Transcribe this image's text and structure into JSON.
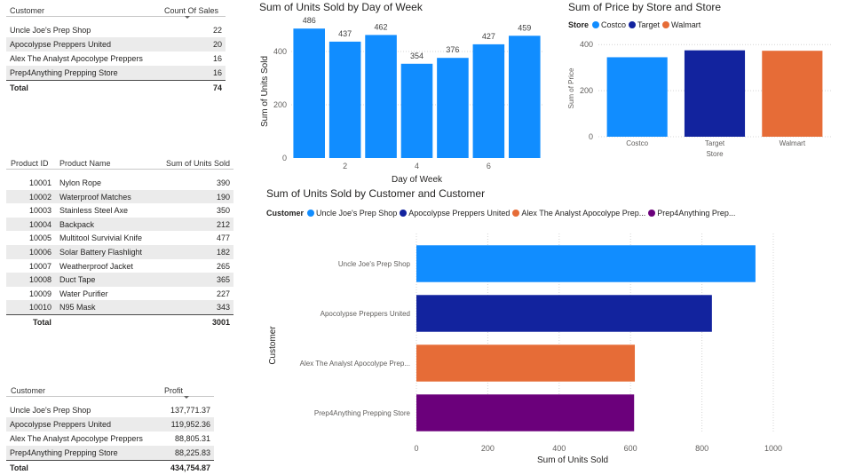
{
  "sales_table": {
    "headers": [
      "Customer",
      "Count Of Sales"
    ],
    "rows": [
      [
        "Uncle Joe's Prep Shop",
        "22"
      ],
      [
        "Apocolypse Preppers United",
        "20"
      ],
      [
        "Alex The Analyst Apocolype Preppers",
        "16"
      ],
      [
        "Prep4Anything Prepping Store",
        "16"
      ]
    ],
    "total": [
      "Total",
      "74"
    ]
  },
  "product_table": {
    "headers": [
      "Product ID",
      "Product Name",
      "Sum of Units Sold"
    ],
    "rows": [
      [
        "10001",
        "Nylon Rope",
        "390"
      ],
      [
        "10002",
        "Waterproof Matches",
        "190"
      ],
      [
        "10003",
        "Stainless Steel Axe",
        "350"
      ],
      [
        "10004",
        "Backpack",
        "212"
      ],
      [
        "10005",
        "Multitool Survivial Knife",
        "477"
      ],
      [
        "10006",
        "Solar Battery Flashlight",
        "182"
      ],
      [
        "10007",
        "Weatherproof Jacket",
        "265"
      ],
      [
        "10008",
        "Duct Tape",
        "365"
      ],
      [
        "10009",
        "Water Purifier",
        "227"
      ],
      [
        "10010",
        "N95 Mask",
        "343"
      ]
    ],
    "total": [
      "Total",
      "3001"
    ]
  },
  "profit_table": {
    "headers": [
      "Customer",
      "Profit"
    ],
    "rows": [
      [
        "Uncle Joe's Prep Shop",
        "137,771.37"
      ],
      [
        "Apocolypse Preppers United",
        "119,952.36"
      ],
      [
        "Alex The Analyst Apocolype Preppers",
        "88,805.31"
      ],
      [
        "Prep4Anything Prepping Store",
        "88,225.83"
      ]
    ],
    "total": [
      "Total",
      "434,754.87"
    ]
  },
  "chart_data": [
    {
      "type": "bar",
      "title": "Sum of Units Sold by Day of Week",
      "xlabel": "Day of Week",
      "ylabel": "Sum of Units Sold",
      "x": [
        1,
        2,
        3,
        4,
        5,
        6,
        7
      ],
      "values": [
        486,
        437,
        462,
        354,
        376,
        427,
        459
      ],
      "data_labels": [
        "486",
        "437",
        "462",
        "354",
        "376",
        "427",
        "459"
      ],
      "x_ticks": [
        "2",
        "4",
        "6"
      ],
      "y_ticks": [
        "0",
        "200",
        "400"
      ],
      "ylim": [
        0,
        500
      ],
      "color": "#118dff",
      "grid": true
    },
    {
      "type": "bar",
      "title": "Sum of Price by Store and Store",
      "xlabel": "Store",
      "ylabel": "Sum of Price",
      "legend_title": "Store",
      "legend_position": "top-left",
      "categories": [
        "Costco",
        "Target",
        "Walmart"
      ],
      "values": [
        345,
        375,
        373
      ],
      "colors": [
        "#118dff",
        "#12239e",
        "#e66c37"
      ],
      "y_ticks": [
        "0",
        "200",
        "400"
      ],
      "ylim": [
        0,
        420
      ],
      "grid": true
    },
    {
      "type": "bar",
      "orientation": "horizontal",
      "title": "Sum of Units Sold by Customer and Customer",
      "xlabel": "Sum of Units Sold",
      "ylabel": "Customer",
      "legend_title": "Customer",
      "legend_position": "top-left",
      "legend_entries": [
        "Uncle Joe's Prep Shop",
        "Apocolypse Preppers United",
        "Alex The Analyst Apocolype Prep...",
        "Prep4Anything Prep..."
      ],
      "categories": [
        "Uncle Joe's Prep Shop",
        "Apocolypse Preppers United",
        "Alex The Analyst Apocolype Prep...",
        "Prep4Anything Prepping Store"
      ],
      "values": [
        950,
        828,
        612,
        610
      ],
      "colors": [
        "#118dff",
        "#12239e",
        "#e66c37",
        "#6b007b"
      ],
      "x_ticks": [
        "0",
        "200",
        "400",
        "600",
        "800",
        "1000"
      ],
      "xlim": [
        0,
        1000
      ],
      "grid": true
    }
  ]
}
